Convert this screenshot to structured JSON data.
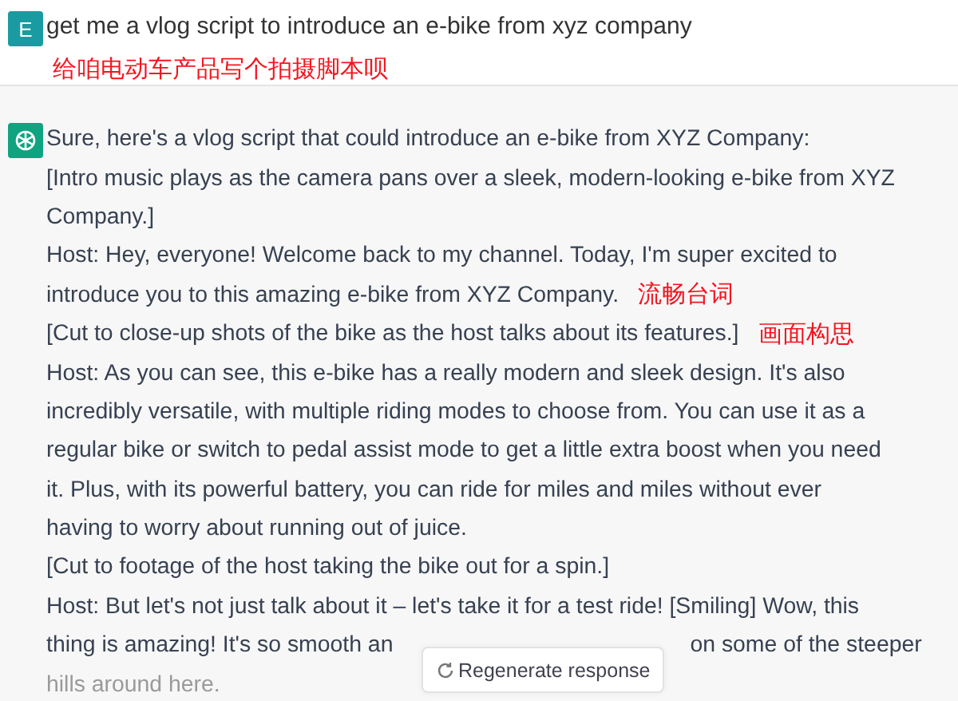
{
  "user_message": {
    "avatar": "E",
    "text": "get me a vlog script to introduce an e-bike from xyz company",
    "note": "给咱电动车产品写个拍摄脚本呗"
  },
  "assistant_message": {
    "lines": [
      {
        "text": "Sure, here's a vlog script that could introduce an e-bike from XYZ Company:"
      },
      {
        "text": "[Intro music plays as the camera pans over a sleek, modern-looking e-bike from XYZ"
      },
      {
        "text": "Company.]"
      },
      {
        "text": "Host: Hey, everyone! Welcome back to my channel. Today, I'm super excited to"
      },
      {
        "text": "introduce you to this amazing e-bike from XYZ Company.",
        "note": "流畅台词"
      },
      {
        "text": "[Cut to close-up shots of the bike as the host talks about its features.]",
        "note": "画面构思"
      },
      {
        "text": "Host: As you can see, this e-bike has a really modern and sleek design. It's also"
      },
      {
        "text": "incredibly versatile, with multiple riding modes to choose from. You can use it as a"
      },
      {
        "text": "regular bike or switch to pedal assist mode to get a little extra boost when you need"
      },
      {
        "text": "it. Plus, with its powerful battery, you can ride for miles and miles without ever"
      },
      {
        "text": "having to worry about running out of juice."
      },
      {
        "text": "[Cut to footage of the host taking the bike out for a spin.]"
      },
      {
        "text": "Host: But let's not just talk about it – let's take it for a test ride! [Smiling] Wow, this"
      },
      {
        "text": "thing is amazing! It's so smooth an",
        "text_after": "on some of the steeper"
      },
      {
        "text": "hills around here."
      }
    ]
  },
  "regenerate_button": {
    "label": "Regenerate response"
  }
}
